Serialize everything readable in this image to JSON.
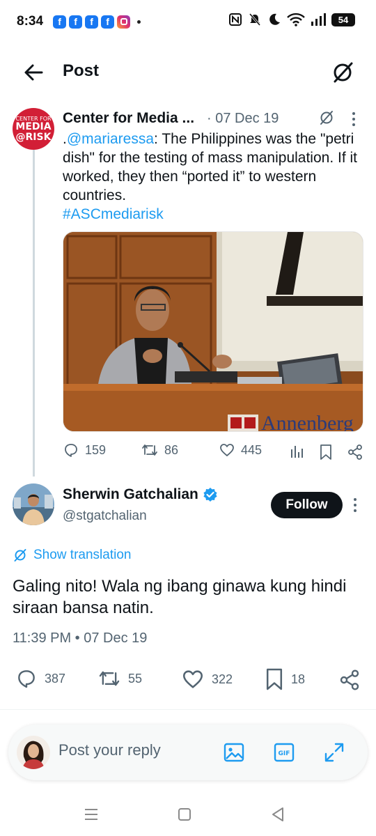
{
  "status_bar": {
    "time": "8:34",
    "notifications": [
      "facebook-icon",
      "facebook-icon",
      "facebook-icon",
      "facebook-icon",
      "instagram-icon"
    ],
    "battery": "54"
  },
  "header": {
    "title": "Post"
  },
  "parent_tweet": {
    "avatar_text": [
      "CENTER FOR",
      "MEDIA",
      "@RISK"
    ],
    "author": "Center for Media ...",
    "date": "· 07 Dec 19",
    "text_prefix": ".",
    "mention": "@mariaressa",
    "text_body": ": The Philippines was the \"petri dish\" for the testing of mass manipulation. If it worked, they then “ported it” to western countries.",
    "hashtag": "#ASCmediarisk",
    "podium_sign": "Annenberg",
    "replies": "159",
    "retweets": "86",
    "likes": "445"
  },
  "main_tweet": {
    "author": "Sherwin Gatchalian",
    "handle": "@stgatchalian",
    "follow_label": "Follow",
    "show_translation": "Show translation",
    "text": "Galing nito! Wala ng ibang ginawa kung hindi siraan bansa natin.",
    "timestamp": "11:39 PM • 07 Dec 19",
    "replies": "387",
    "retweets": "55",
    "likes": "322",
    "bookmarks": "18"
  },
  "reply_bar": {
    "placeholder": "Post your reply"
  },
  "colors": {
    "accent": "#1d9bf0",
    "text": "#0f1419",
    "muted": "#536471",
    "verified": "#1d9bf0",
    "org_red": "#d21f36"
  }
}
